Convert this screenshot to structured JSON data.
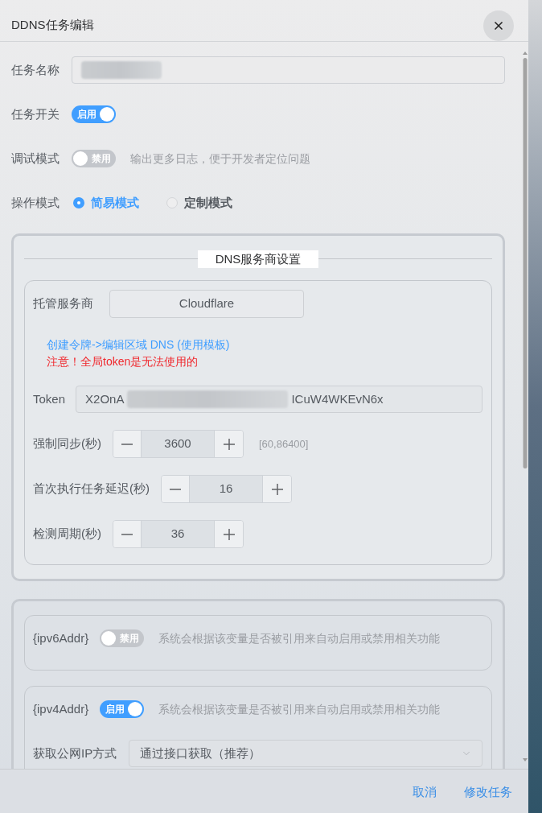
{
  "dialog": {
    "title": "DDNS任务编辑"
  },
  "basic": [
    {
      "kind": "text",
      "label": "任务名称",
      "redacted": true
    },
    {
      "kind": "switch",
      "label": "任务开关",
      "on": true,
      "switch_text": "启用"
    },
    {
      "kind": "switch",
      "label": "调试模式",
      "on": false,
      "switch_text": "禁用",
      "hint": "输出更多日志，便于开发者定位问题"
    },
    {
      "kind": "radio",
      "label": "操作模式",
      "options": [
        {
          "label": "简易模式",
          "selected": true
        },
        {
          "label": "定制模式",
          "selected": false
        }
      ]
    }
  ],
  "dns_section": {
    "legend": "DNS服务商设置",
    "provider_label": "托管服务商",
    "provider": "Cloudflare",
    "link": "创建令牌->编辑区域 DNS (使用模板)",
    "warning": "注意！全局token是无法使用的",
    "token": {
      "label": "Token",
      "value_start": "X2OnA",
      "value_end": "ICuW4WKEvN6x",
      "redacted": true
    },
    "steppers": [
      {
        "label": "强制同步(秒)",
        "value": "3600",
        "range": "[60,86400]"
      },
      {
        "label": "首次执行任务延迟(秒)",
        "value": "16"
      },
      {
        "label": "检测周期(秒)",
        "value": "36"
      }
    ]
  },
  "address_section": {
    "groups": [
      {
        "variable": "{ipv6Addr}",
        "on": false,
        "switch_text": "禁用",
        "hint": "系统会根据该变量是否被引用来自动启用或禁用相关功能"
      },
      {
        "variable": "{ipv4Addr}",
        "on": true,
        "switch_text": "启用",
        "hint": "系统会根据该变量是否被引用来自动启用或禁用相关功能",
        "select": {
          "label": "获取公网IP方式",
          "value": "通过接口获取（推荐）"
        }
      }
    ]
  },
  "footer": {
    "buttons": [
      "取消",
      "修改任务"
    ]
  }
}
